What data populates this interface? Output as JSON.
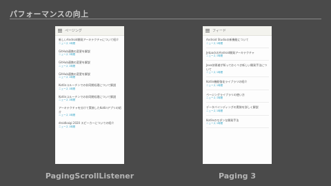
{
  "slide": {
    "title": "パフォーマンスの向上"
  },
  "left_phone": {
    "appbar_title": "ページング",
    "items": [
      {
        "title": "新しいAndroid開発アーキテクチャについて紹介",
        "source": "ニュース 1時間"
      },
      {
        "title": "GitHub連携の変更を解説",
        "source": "ニュース 1時間"
      },
      {
        "title": "GitHub連携の変更を解説",
        "source": "ニュース 1時間"
      },
      {
        "title": "GitHub連携の変更を解説",
        "source": "ニュース 1時間"
      },
      {
        "title": "Kotlinコルーチンでの非同期処理について解説",
        "source": "ニュース 1時間"
      },
      {
        "title": "Kotlinコルーチンでの非同期処理について解説",
        "source": "ニュース 1時間"
      },
      {
        "title": "アーキテクチャを分けて実装したKotlinアプリの紹介",
        "source": "ニュース 1時間"
      },
      {
        "title": "droidkaigi 2020 スピーカーについての紹介",
        "source": "ニュース 1時間"
      }
    ]
  },
  "right_phone": {
    "appbar_title": "フィード",
    "items": [
      {
        "title": "Android Studioの新機能について",
        "source": "ニュース 1時間"
      },
      {
        "title": "JetpackのAndroid開発アーキテクチャ",
        "source": "ニュース 1時間"
      },
      {
        "title": "Java技術者が知っておくべき新しい開発手法について",
        "source": "ニュース 1時間"
      },
      {
        "title": "Kotlin機能強化ライブラリの紹介",
        "source": "ニュース 1時間"
      },
      {
        "title": "ページングライブラリの使い方",
        "source": "ニュース 1時間"
      },
      {
        "title": "データバインディングの実装を詳しく解説",
        "source": "ニュース 1時間"
      },
      {
        "title": "Kotlinのモダンな開発手法",
        "source": "ニュース 1時間"
      }
    ]
  },
  "captions": {
    "left": "PagingScrollListener",
    "right": "Paging 3"
  }
}
